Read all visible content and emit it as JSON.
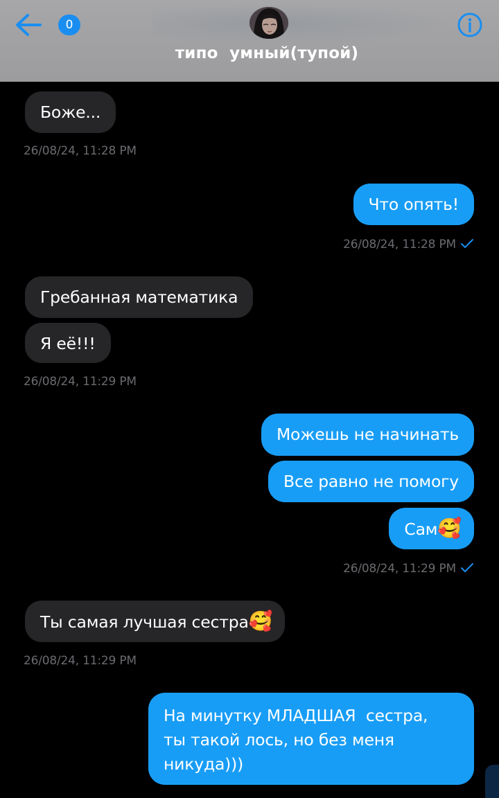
{
  "header": {
    "unread_count": "0",
    "contact_name": "типо  умный(тупой)",
    "back_icon": "arrow-left-icon",
    "info_icon": "info-circle-icon",
    "accent_color": "#1a8ef0"
  },
  "messages": [
    {
      "direction": "in",
      "text": "Боже..."
    },
    {
      "direction": "in",
      "timestamp": "26/08/24, 11:28 PM"
    },
    {
      "direction": "out",
      "text": "Что опять!"
    },
    {
      "direction": "out",
      "timestamp": "26/08/24, 11:28 PM"
    },
    {
      "direction": "in",
      "text": "Гребанная математика"
    },
    {
      "direction": "in",
      "text": "Я её!!!"
    },
    {
      "direction": "in",
      "timestamp": "26/08/24, 11:29 PM"
    },
    {
      "direction": "out",
      "text": "Можешь не начинать"
    },
    {
      "direction": "out",
      "text": "Все равно не помогу"
    },
    {
      "direction": "out",
      "text": "Сам",
      "emoji": "🥰"
    },
    {
      "direction": "out",
      "timestamp": "26/08/24, 11:29 PM"
    },
    {
      "direction": "in",
      "text": "Ты самая лучшая сестра",
      "emoji": "🥰"
    },
    {
      "direction": "in",
      "timestamp": "26/08/24, 11:29 PM"
    },
    {
      "direction": "out",
      "lines": [
        "На минутку МЛАДШАЯ  сестра,",
        "ты такой лось, но без меня",
        "никуда)))"
      ]
    }
  ],
  "colors": {
    "background": "#000000",
    "incoming_bubble": "#262527",
    "outgoing_bubble": "#189df6",
    "timestamp": "#6b6b70",
    "read_tick": "#1a8ef0"
  }
}
